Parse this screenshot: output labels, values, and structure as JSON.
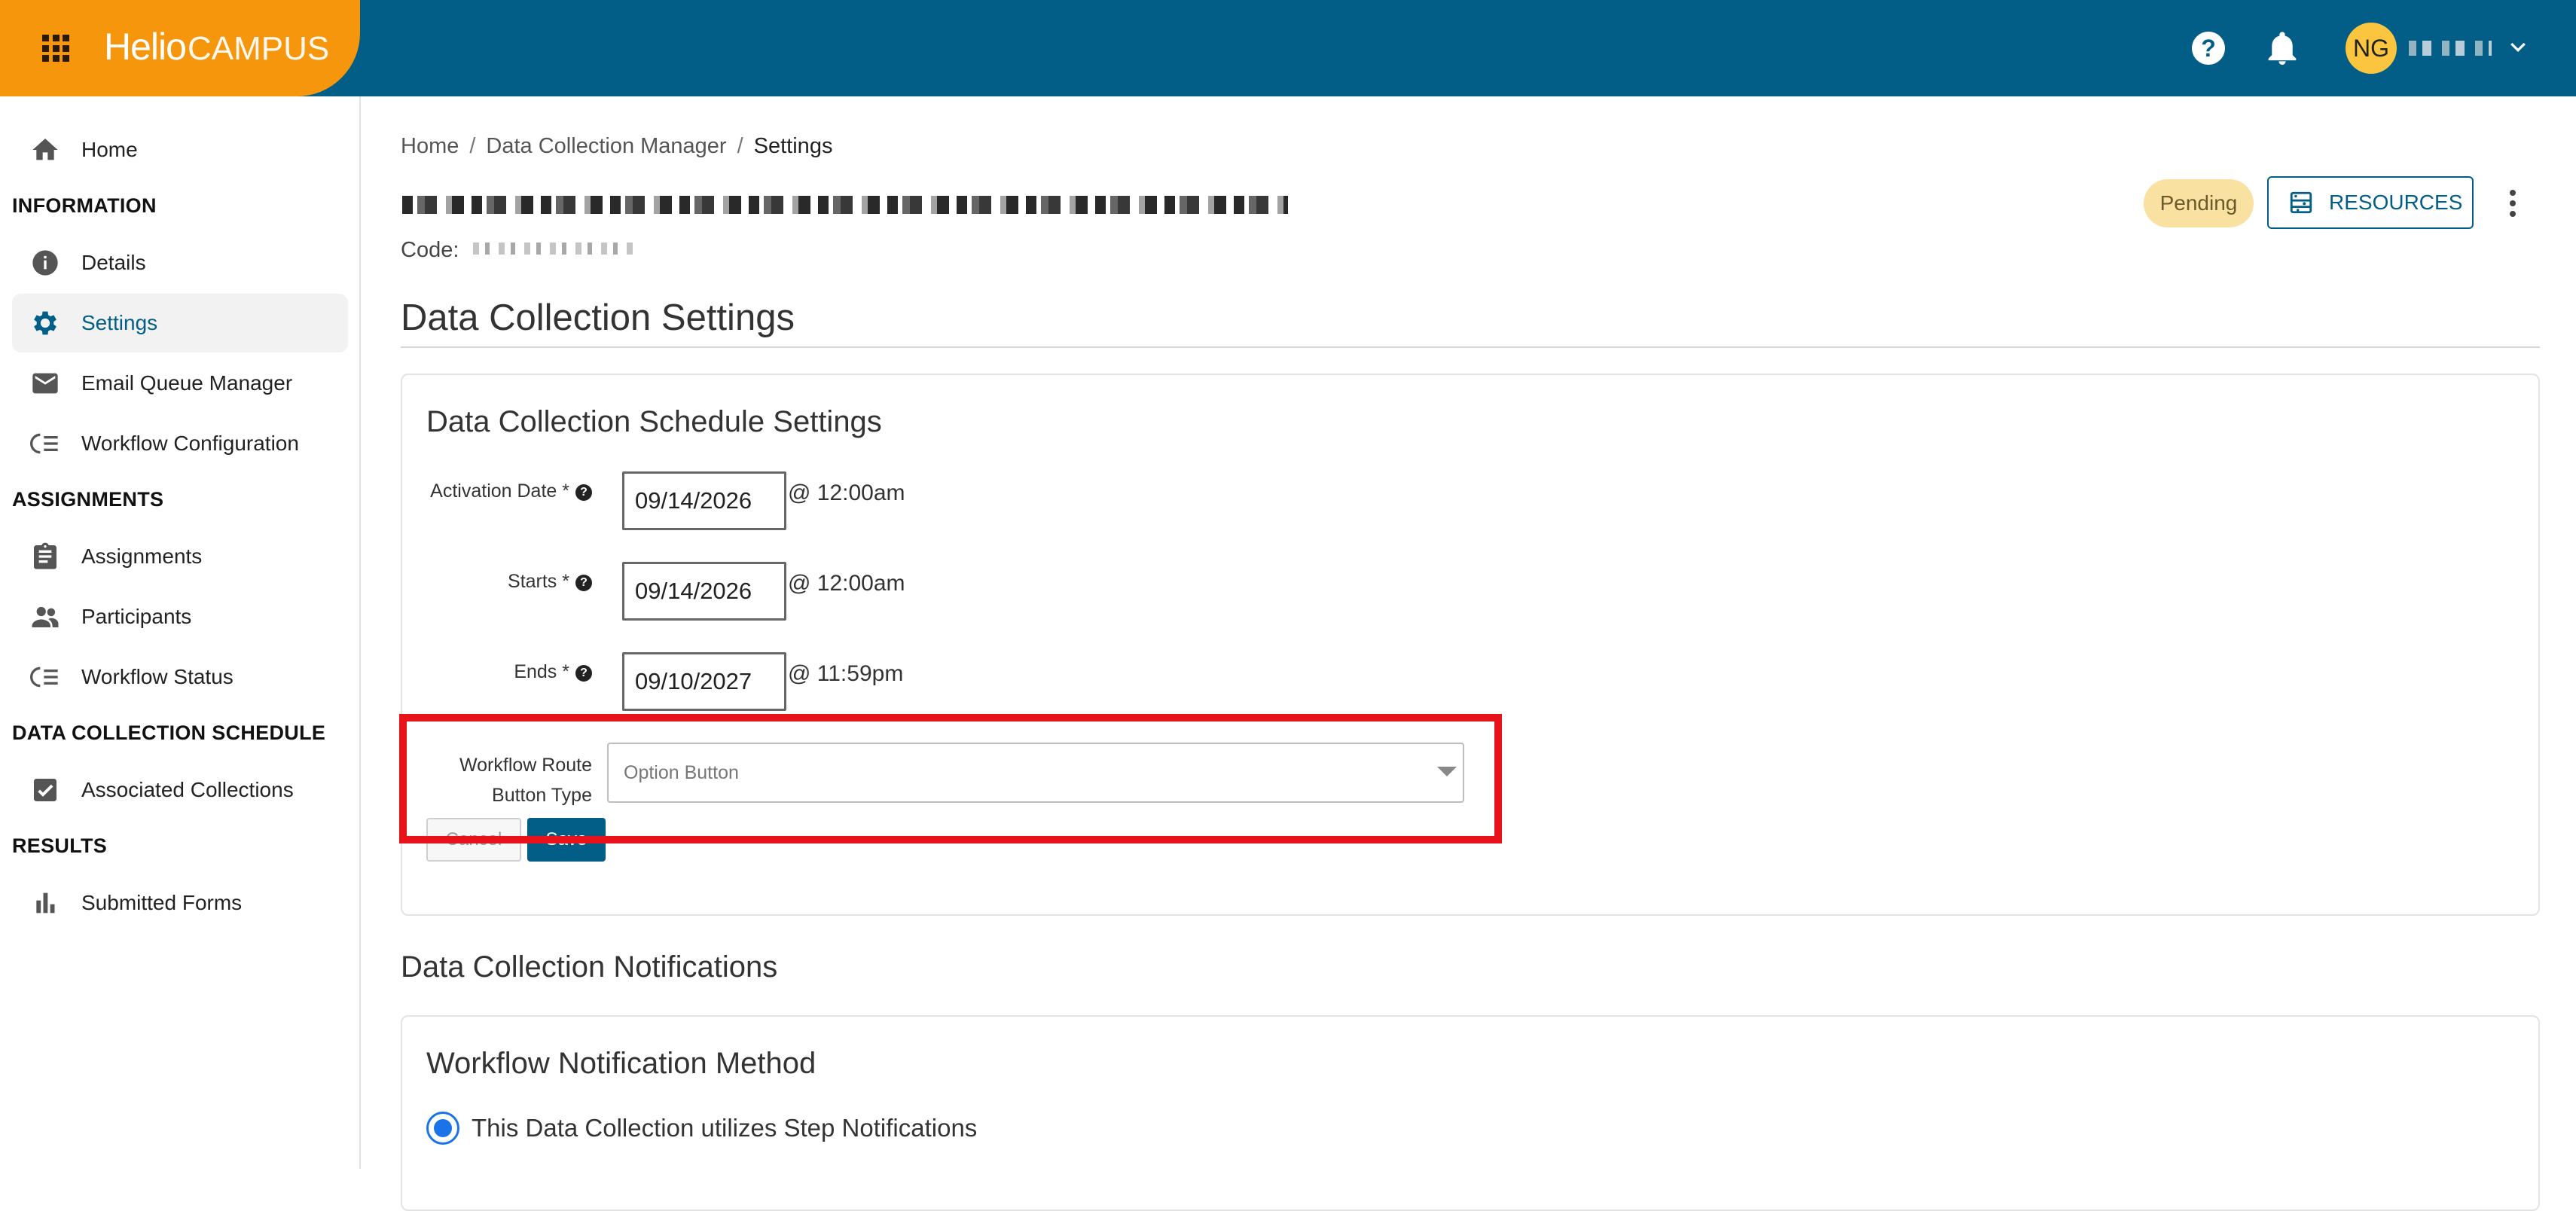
{
  "app": {
    "brand_part1": "Helio",
    "brand_part2": "CAMPUS",
    "user_initials": "NG"
  },
  "sidebar": {
    "home": "Home",
    "sections": {
      "information": "INFORMATION",
      "assignments": "ASSIGNMENTS",
      "schedule": "DATA COLLECTION SCHEDULE",
      "results": "RESULTS"
    },
    "items": {
      "details": "Details",
      "settings": "Settings",
      "email_queue": "Email Queue Manager",
      "workflow_config": "Workflow Configuration",
      "assignments": "Assignments",
      "participants": "Participants",
      "workflow_status": "Workflow Status",
      "associated": "Associated Collections",
      "submitted": "Submitted Forms"
    }
  },
  "breadcrumb": {
    "home": "Home",
    "sep": "/",
    "manager": "Data Collection Manager",
    "current": "Settings"
  },
  "header": {
    "code_label": "Code:",
    "status": "Pending",
    "resources": "RESOURCES"
  },
  "page": {
    "title": "Data Collection Settings",
    "schedule_card_title": "Data Collection Schedule Settings"
  },
  "form": {
    "activation_label": "Activation Date *",
    "activation_date": "09/14/2026",
    "activation_time": "@ 12:00am",
    "starts_label": "Starts *",
    "starts_date": "09/14/2026",
    "starts_time": "@ 12:00am",
    "ends_label": "Ends *",
    "ends_date": "09/10/2027",
    "ends_time": "@ 11:59pm",
    "route_label_line1": "Workflow Route",
    "route_label_line2": "Button Type",
    "route_value": "Option Button",
    "cancel": "Cancel",
    "save": "Save",
    "help_glyph": "?"
  },
  "notifications": {
    "section_title": "Data Collection Notifications",
    "card_title": "Workflow Notification Method",
    "option_label": "This Data Collection utilizes Step Notifications"
  },
  "colors": {
    "topbar": "#025e87",
    "brand": "#f6960c",
    "highlight": "#e8131a",
    "avatar": "#fbc53f",
    "pending": "#f9e1a1"
  }
}
